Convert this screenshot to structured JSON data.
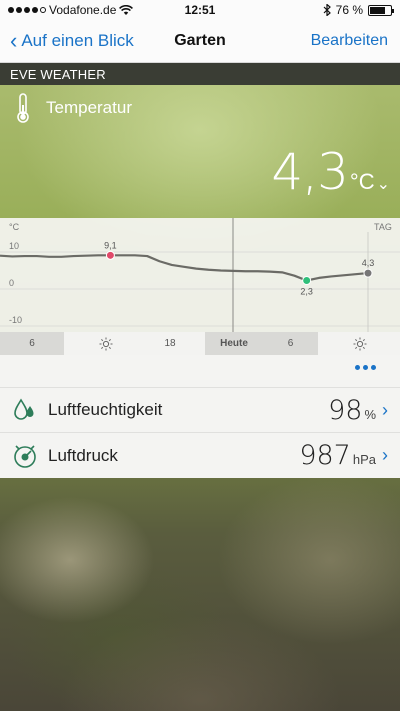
{
  "status_bar": {
    "carrier": "Vodafone.de",
    "time": "12:51",
    "battery_percent": "76 %",
    "battery_level": 0.76
  },
  "nav": {
    "back_label": "Auf einen Blick",
    "title": "Garten",
    "edit_label": "Bearbeiten"
  },
  "section": {
    "title": "EVE WEATHER"
  },
  "temperature": {
    "label": "Temperatur",
    "value": "4,3",
    "unit": "°C"
  },
  "chart_data": {
    "type": "line",
    "y_unit_label": "°C",
    "range_label": "TAG",
    "yticks": [
      "10",
      "0",
      "-10"
    ],
    "ylim": [
      -10,
      10
    ],
    "x": [
      0,
      0.8,
      1.6,
      2.4,
      3.2,
      4.0,
      4.8,
      5.6,
      6.4,
      7.2,
      8.0,
      8.8,
      9.6,
      10.4,
      11.2,
      12.0,
      12.8,
      13.6,
      14.4,
      15.2,
      16.0,
      16.8,
      17.6,
      18.4,
      19.2,
      20.0,
      20.8,
      21.6,
      22.4,
      23.2,
      24.0
    ],
    "values": [
      9.0,
      8.8,
      8.9,
      8.9,
      8.7,
      8.7,
      8.9,
      9.0,
      9.1,
      9.1,
      9.1,
      9.1,
      8.9,
      7.5,
      6.5,
      6.0,
      5.5,
      5.2,
      5.0,
      4.9,
      4.8,
      4.8,
      4.7,
      4.5,
      3.6,
      2.3,
      3.0,
      3.4,
      3.7,
      4.0,
      4.3
    ],
    "series_color": "#6b6b66",
    "markers": [
      {
        "label": "9,1",
        "x": 7.2,
        "y": 9.1,
        "color": "#e04a6a"
      },
      {
        "label": "2,3",
        "x": 20.0,
        "y": 2.3,
        "color": "#2fbf7a"
      },
      {
        "label": "4,3",
        "x": 24.0,
        "y": 4.3,
        "color": "#777777"
      }
    ],
    "x_axis": {
      "labels": [
        "6",
        "18",
        "Heute",
        "6"
      ],
      "today_label": "Heute"
    }
  },
  "humidity": {
    "label": "Luftfeuchtigkeit",
    "value": "98",
    "unit": "%"
  },
  "pressure": {
    "label": "Luftdruck",
    "value": "987",
    "unit": "hPa"
  },
  "colors": {
    "accent": "#1a73c7",
    "header_bg": "#3a3d34"
  }
}
